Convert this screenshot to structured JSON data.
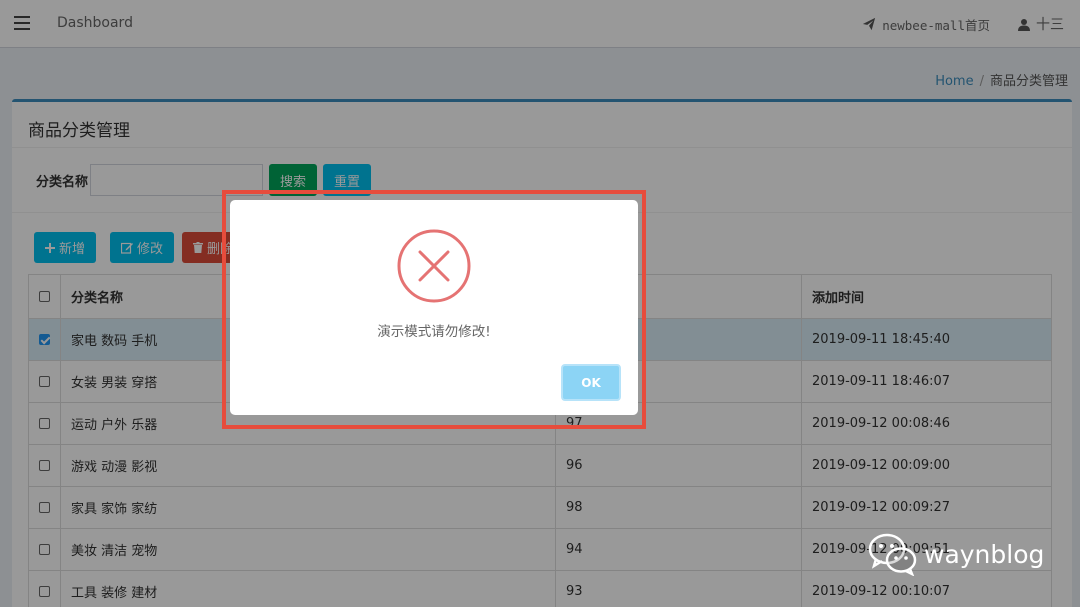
{
  "navbar": {
    "brand": "Dashboard",
    "home_link": "newbee-mall首页",
    "user": "十三"
  },
  "breadcrumb": {
    "home": "Home",
    "separator": "/",
    "current": "商品分类管理"
  },
  "box": {
    "title": "商品分类管理"
  },
  "search": {
    "label": "分类名称",
    "value": "",
    "search_button": "搜索",
    "reset_button": "重置"
  },
  "toolbar": {
    "add": "新增",
    "edit": "修改",
    "delete": "删除"
  },
  "table": {
    "headers": [
      "分类名称",
      "",
      "添加时间"
    ],
    "rows": [
      {
        "name": "家电 数码 手机",
        "rank": "",
        "time": "2019-09-11 18:45:40",
        "checked": true
      },
      {
        "name": "女装 男装 穿搭",
        "rank": "",
        "time": "2019-09-11 18:46:07",
        "checked": false
      },
      {
        "name": "运动 户外 乐器",
        "rank": "97",
        "time": "2019-09-12 00:08:46",
        "checked": false
      },
      {
        "name": "游戏 动漫 影视",
        "rank": "96",
        "time": "2019-09-12 00:09:00",
        "checked": false
      },
      {
        "name": "家具 家饰 家纺",
        "rank": "98",
        "time": "2019-09-12 00:09:27",
        "checked": false
      },
      {
        "name": "美妆 清洁 宠物",
        "rank": "94",
        "time": "2019-09-12 00:09:51",
        "checked": false
      },
      {
        "name": "工具 装修 建材",
        "rank": "93",
        "time": "2019-09-12 00:10:07",
        "checked": false
      }
    ]
  },
  "modal": {
    "message": "演示模式请勿修改!",
    "ok": "OK"
  },
  "watermark": {
    "text": "waynblog"
  },
  "colors": {
    "primary": "#3c8dbc",
    "success": "#00a65a",
    "info": "#00c0ef",
    "danger": "#dd4b39",
    "error_icon": "#e57373",
    "highlight": "#e74c3c",
    "ok_button": "#8cd4f5"
  }
}
